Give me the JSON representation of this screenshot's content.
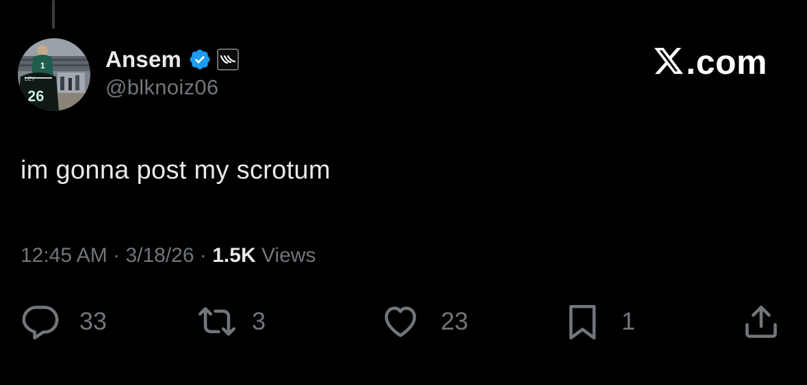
{
  "author": {
    "display_name": "Ansem",
    "handle": "@blknoiz06",
    "avatar_jersey_number": "26",
    "verified_color": "#1d9bf0"
  },
  "brand": {
    "label": ".com"
  },
  "tweet": {
    "text": "im gonna post my scrotum",
    "time": "12:45 AM",
    "date": "3/18/26",
    "separator": "·",
    "views_count": "1.5K",
    "views_label": "Views"
  },
  "actions": {
    "replies": "33",
    "reposts": "3",
    "likes": "23",
    "bookmarks": "1"
  },
  "icons": {
    "reply": "speech-bubble",
    "repost": "two-arrows-loop",
    "like": "heart",
    "bookmark": "bookmark",
    "share": "upload-arrow"
  },
  "colors": {
    "background": "#000000",
    "primary_text": "#e7e9ea",
    "secondary_text": "#71767b"
  }
}
